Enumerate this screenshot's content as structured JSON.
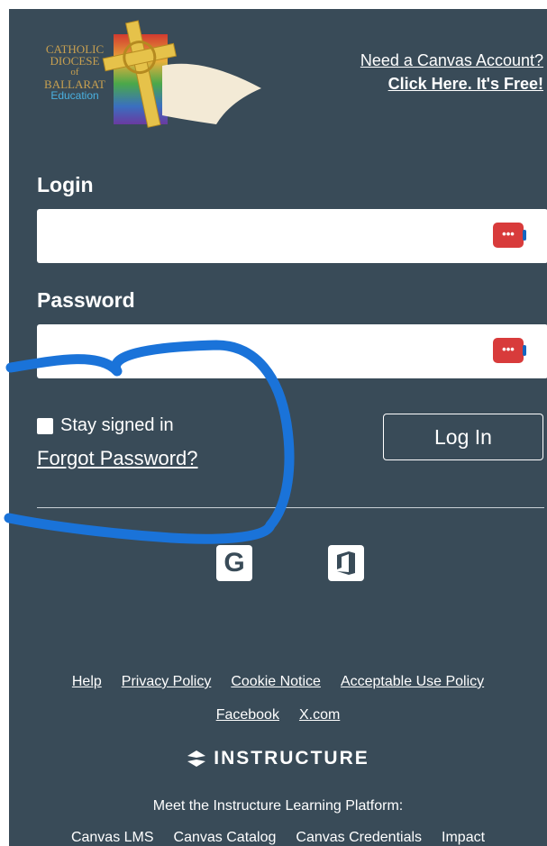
{
  "logo": {
    "lines": [
      "CATHOLIC",
      "DIOCESE",
      "of",
      "BALLARAT",
      "Education"
    ]
  },
  "header": {
    "need_account": "Need a Canvas Account?",
    "click_here": "Click Here. It's Free!"
  },
  "form": {
    "login_label": "Login",
    "login_value": "",
    "password_label": "Password",
    "password_value": "",
    "password_manager_icon_text": "•••",
    "stay_signed_in": "Stay signed in",
    "forgot_password": "Forgot Password?",
    "login_button": "Log In"
  },
  "sso": {
    "google_glyph": "G"
  },
  "footer": {
    "links_row1": [
      "Help",
      "Privacy Policy",
      "Cookie Notice",
      "Acceptable Use Policy"
    ],
    "links_row2": [
      "Facebook",
      "X.com"
    ],
    "brand": "INSTRUCTURE",
    "tagline": "Meet the Instructure Learning Platform:",
    "products": [
      "Canvas LMS",
      "Canvas Catalog",
      "Canvas Credentials",
      "Impact"
    ]
  },
  "colors": {
    "background": "#394b58",
    "annotation": "#1a73d9",
    "password_manager": "#d83b3b"
  }
}
